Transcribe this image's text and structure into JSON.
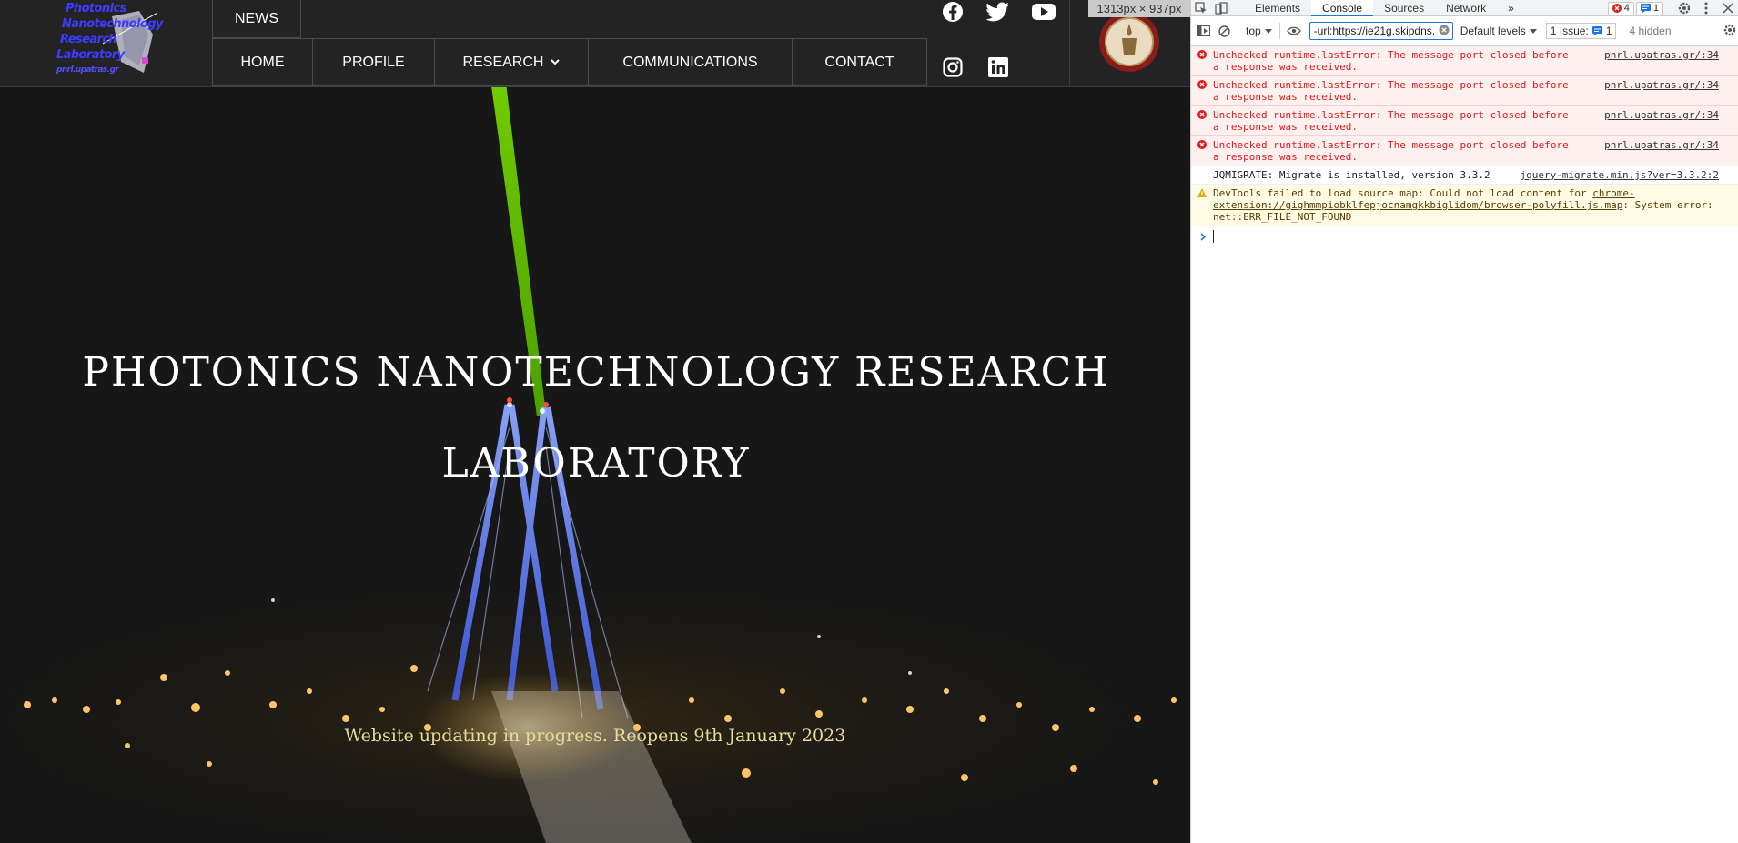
{
  "site": {
    "logo_lines": [
      "Photonics",
      "Nanotechnology",
      "Research",
      "Laboratory"
    ],
    "logo_url": "pnrl.upatras.gr",
    "news_label": "NEWS",
    "nav": [
      {
        "label": "HOME"
      },
      {
        "label": "PROFILE"
      },
      {
        "label": "RESEARCH",
        "has_dropdown": true
      },
      {
        "label": "COMMUNICATIONS"
      },
      {
        "label": "CONTACT"
      }
    ],
    "social_icons": [
      "facebook-icon",
      "twitter-icon",
      "youtube-icon",
      "instagram-icon",
      "linkedin-icon"
    ],
    "hero_title_line1": "PHOTONICS NANOTECHNOLOGY RESEARCH",
    "hero_title_line2": "LABORATORY",
    "hero_subtitle": "Website updating in progress. Reopens 9th January 2023",
    "viewport_size_tooltip": "1313px × 937px",
    "colors": {
      "header_bg": "#232323",
      "subtitle": "#e8dc9c",
      "laser": "#6fd200",
      "bridge": "#5b7dff"
    }
  },
  "devtools": {
    "tabs": [
      {
        "label": "Elements",
        "active": false
      },
      {
        "label": "Console",
        "active": true
      },
      {
        "label": "Sources",
        "active": false
      },
      {
        "label": "Network",
        "active": false
      }
    ],
    "more_tabs": "»",
    "error_count": "4",
    "message_count": "1",
    "toolbar": {
      "context": "top",
      "filter_value": "-url:https://ie21g.skipdns.",
      "levels": "Default levels",
      "issues_label": "1 Issue:",
      "issues_count": "1",
      "hidden": "4 hidden"
    },
    "messages": [
      {
        "type": "error",
        "text": "Unchecked runtime.lastError: The message port closed before a response was received.",
        "source": "pnrl.upatras.gr/:34"
      },
      {
        "type": "error",
        "text": "Unchecked runtime.lastError: The message port closed before a response was received.",
        "source": "pnrl.upatras.gr/:34"
      },
      {
        "type": "error",
        "text": "Unchecked runtime.lastError: The message port closed before a response was received.",
        "source": "pnrl.upatras.gr/:34"
      },
      {
        "type": "error",
        "text": "Unchecked runtime.lastError: The message port closed before a response was received.",
        "source": "pnrl.upatras.gr/:34"
      },
      {
        "type": "log",
        "text": "JQMIGRATE: Migrate is installed, version 3.3.2",
        "source": "jquery-migrate.min.js?ver=3.3.2:2"
      }
    ],
    "warning": {
      "prefix": "DevTools failed to load source map: Could not load content for ",
      "link": "chrome-extension://gighmmpiobklfepjocnamgkkbiglidom/browser-polyfill.js.map",
      "suffix": ": System error: net::ERR_FILE_NOT_FOUND"
    },
    "colors": {
      "error_text": "#e01b1b",
      "error_bg": "#fff0f0",
      "warn_bg": "#fffbe5",
      "accent": "#1a73e8"
    }
  }
}
